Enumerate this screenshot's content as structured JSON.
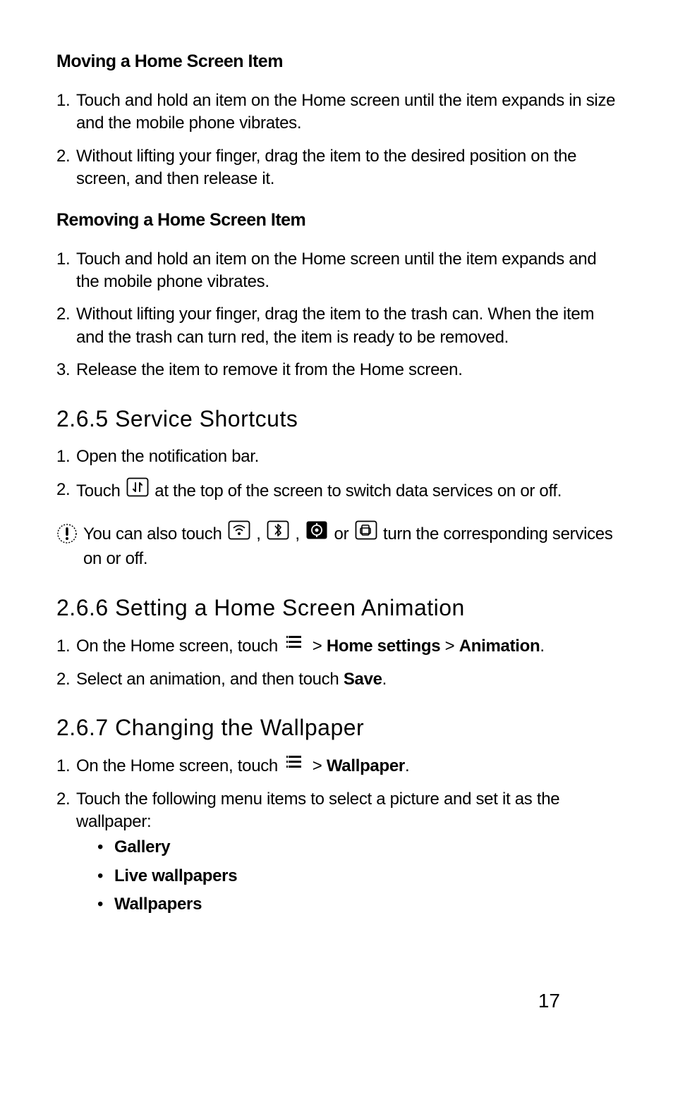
{
  "sections": {
    "moving": {
      "title": "Moving a Home Screen Item",
      "items": [
        "Touch and hold an item on the Home screen until the item expands in size and the mobile phone vibrates.",
        "Without lifting your finger, drag the item to the desired position on the screen, and then release it."
      ]
    },
    "removing": {
      "title": "Removing a Home Screen Item",
      "items": [
        "Touch and hold an item on the Home screen until the item expands and the mobile phone vibrates.",
        "Without lifting your finger, drag the item to the trash can. When the item and the trash can turn red, the item is ready to be removed.",
        "Release the item to remove it from the Home screen."
      ]
    },
    "service": {
      "title": "2.6.5  Service Shortcuts",
      "item1": "Open the notification bar.",
      "item2_pre": "Touch ",
      "item2_post": " at the top of the screen to switch data services on or off.",
      "note_pre": "You can also touch ",
      "note_mid1": " , ",
      "note_mid2": " , ",
      "note_mid3": " or ",
      "note_post": " turn the corresponding services on or off."
    },
    "animation": {
      "title": "2.6.6  Setting a Home Screen Animation",
      "item1_pre": "On the Home screen, touch ",
      "item1_mid": " > ",
      "item1_b1": "Home settings",
      "item1_mid2": " > ",
      "item1_b2": "Animation",
      "item1_end": ".",
      "item2_pre": "Select an animation, and then touch ",
      "item2_b": "Save",
      "item2_end": "."
    },
    "wallpaper": {
      "title": "2.6.7  Changing the Wallpaper",
      "item1_pre": "On the Home screen, touch ",
      "item1_mid": " > ",
      "item1_b": "Wallpaper",
      "item1_end": ".",
      "item2": "Touch the following menu items to select a picture and set it as the wallpaper:",
      "bullets": [
        "Gallery",
        "Live wallpapers",
        "Wallpapers"
      ]
    }
  },
  "page_number": "17"
}
